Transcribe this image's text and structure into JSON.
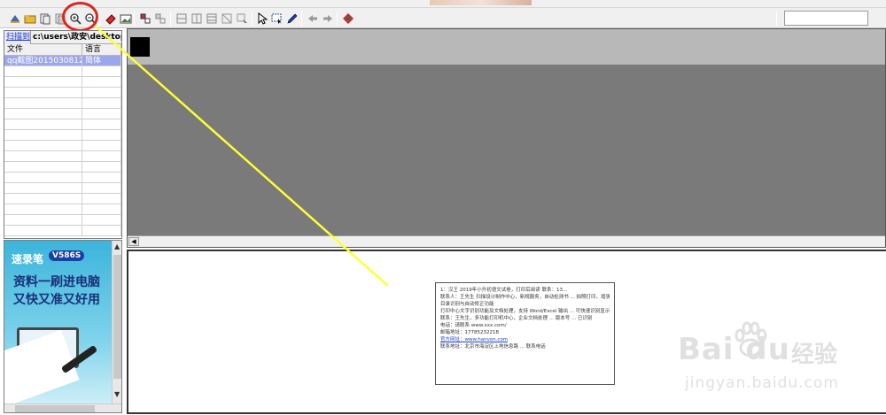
{
  "toolbar": {
    "icons": [
      "open-scan-icon",
      "open-folder-icon",
      "pages-icon",
      "pages-copy-icon",
      "zoom-in-icon",
      "zoom-out-icon",
      "eraser-icon",
      "image-icon",
      "layout-icon",
      "layout-copy-icon",
      "grid-icon",
      "grid2-icon",
      "grid3-icon",
      "table-icon",
      "table-select-icon",
      "pointer-icon",
      "select-region-icon",
      "pencil-icon",
      "arrow-left-icon",
      "arrow-right-icon",
      "color-icon"
    ],
    "search_value": ""
  },
  "left_panel": {
    "tab_scan": "扫描到",
    "tab_path": "c:\\users\\政安\\desktop\\",
    "columns": [
      "文件",
      "语言"
    ],
    "rows": [
      {
        "file": "qq截图20150308122...",
        "lang": "简体"
      }
    ]
  },
  "ad": {
    "brand": "速录笔",
    "model": "V586S",
    "line1": "资料一刷进电脑",
    "line2": "又快又准又好用"
  },
  "document": {
    "lines": [
      "1：汉王 2019年小升初语文试卷，打印后阅读 联系：13...",
      "联系人：王先生 扫描设计制作中心，新规服务，自动检测书 ... 拍照打印，增强识别功能 ...",
      "目录识别与自动修正功能",
      "打印中心文字识别功能及文档处理，支持 Word/Excel 输出 ... 可快速识别显示",
      "联系：王先生，多功能打印机中心，企业文档处理 ... 版本号 ... 已识别",
      "电话：请联系 www.xxx.com/",
      "邮箱地址：17785232218",
      "官方网址：www.hanvon.com",
      "联系地址：北京市海淀区上地信息路 ... 联系电话"
    ],
    "link_line_index": 7
  },
  "watermark": {
    "brand": "Bai du",
    "cn": "经验",
    "url": "jingyan.baidu.com"
  },
  "colors": {
    "highlight_circle": "#e0261c",
    "arrow_line": "#ffff33",
    "selected_row": "#9ba7ec"
  }
}
